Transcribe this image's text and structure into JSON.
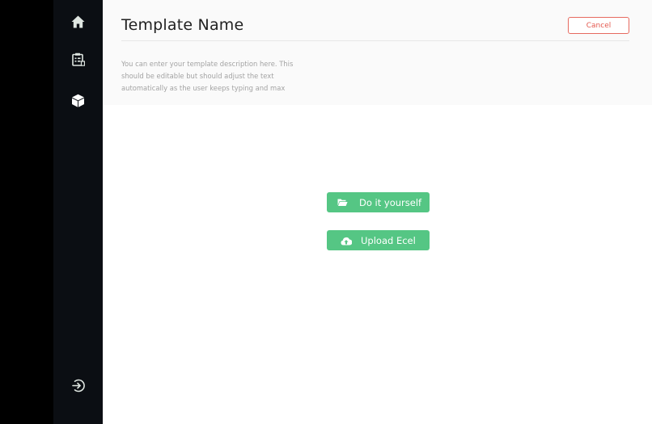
{
  "sidebar": {
    "items": [
      {
        "icon": "home-icon"
      },
      {
        "icon": "clipboard-list-icon"
      },
      {
        "icon": "cube-icon"
      }
    ],
    "footer": {
      "icon": "sign-in-icon"
    }
  },
  "header": {
    "title": "Template Name",
    "description": "You can enter your template description here. This should be editable but should adjust the text automatically as the user keeps typing and max",
    "cancel_label": "Cancel"
  },
  "actions": {
    "diy_label": "Do it yourself",
    "diy_icon": "folder-open-icon",
    "upload_label": "Upload Ecel",
    "upload_icon": "cloud-upload-icon"
  },
  "colors": {
    "sidebar_bg": "#0b0e13",
    "icon_color": "#dfe6e1",
    "accent_green": "#55c684",
    "cancel_red": "#e4584e"
  }
}
